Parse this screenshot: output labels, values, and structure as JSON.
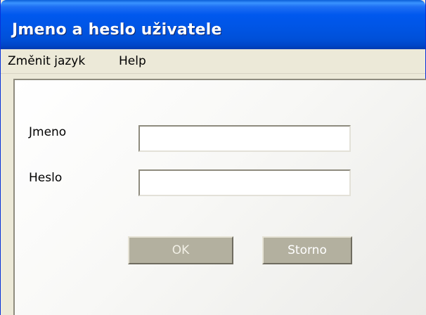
{
  "window": {
    "title": "Jmeno a heslo uživatele"
  },
  "menu": {
    "items": [
      {
        "label": "Změnit jazyk"
      },
      {
        "label": "Help"
      }
    ]
  },
  "form": {
    "username_label": "Jmeno",
    "username_value": "",
    "password_label": "Heslo",
    "password_value": ""
  },
  "buttons": {
    "ok_label": "OK",
    "ok_enabled": false,
    "cancel_label": "Storno"
  },
  "colors": {
    "title_bar": "#0055e5",
    "window_face": "#ece9d8",
    "button_face": "#b3b09f"
  }
}
